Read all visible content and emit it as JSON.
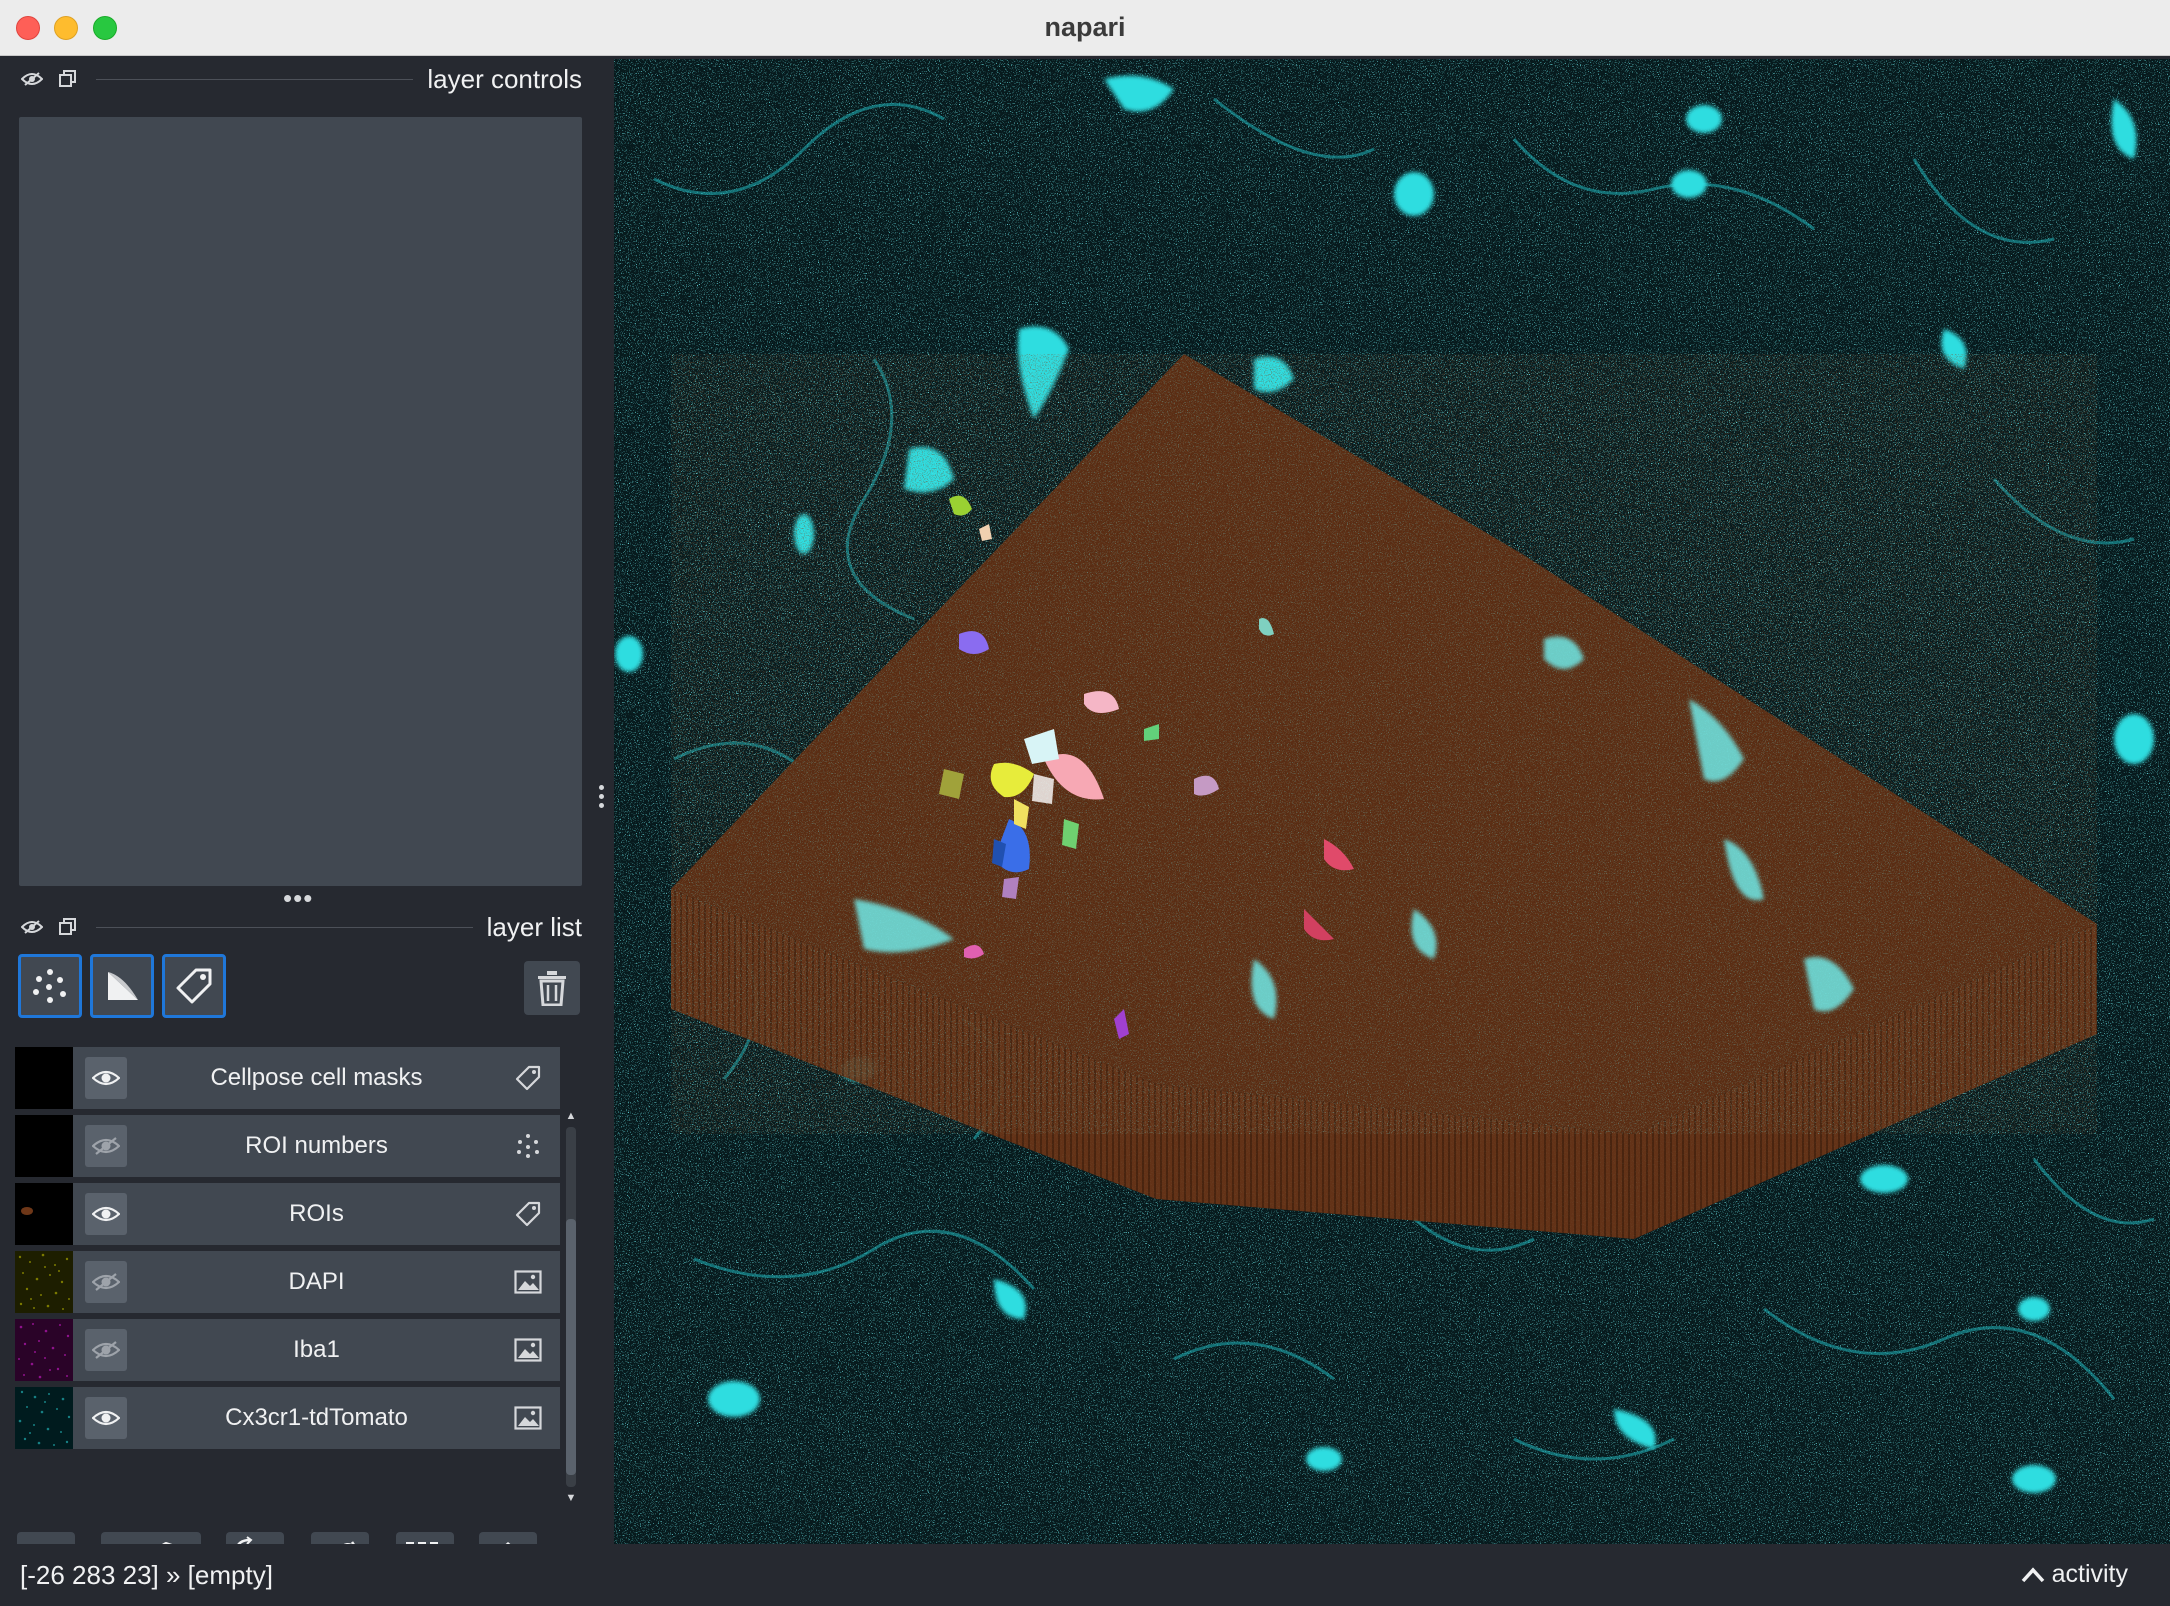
{
  "window": {
    "title": "napari"
  },
  "dock": {
    "controls_title": "layer controls",
    "list_title": "layer list"
  },
  "layer_tools": [
    {
      "name": "new-points-layer",
      "icon": "points-icon"
    },
    {
      "name": "new-shapes-layer",
      "icon": "shapes-icon"
    },
    {
      "name": "new-labels-layer",
      "icon": "labels-icon"
    }
  ],
  "layers": [
    {
      "name": "Cellpose cell masks",
      "visible": true,
      "type": "labels",
      "thumb": "#000000"
    },
    {
      "name": "ROI numbers",
      "visible": false,
      "type": "points",
      "thumb": "#000000"
    },
    {
      "name": "ROIs",
      "visible": true,
      "type": "labels",
      "thumb": "#000000"
    },
    {
      "name": "DAPI",
      "visible": false,
      "type": "image",
      "thumb": "#1d1e00"
    },
    {
      "name": "Iba1",
      "visible": false,
      "type": "image",
      "thumb": "#2a0328"
    },
    {
      "name": "Cx3cr1-tdTomato",
      "visible": true,
      "type": "image",
      "thumb": "#001b1e"
    }
  ],
  "bottom_buttons": [
    "console-button",
    "ndisplay-toggle-button",
    "roll-axes-button",
    "transpose-button",
    "grid-button",
    "home-button"
  ],
  "status": {
    "coords": "[-26 283 23] » [empty]",
    "activity": "activity"
  },
  "colors": {
    "accent": "#1f77d9",
    "panel": "#414851",
    "background": "#262930",
    "cyan": "#2ad4d8",
    "roi_volume": "#6e3718"
  }
}
